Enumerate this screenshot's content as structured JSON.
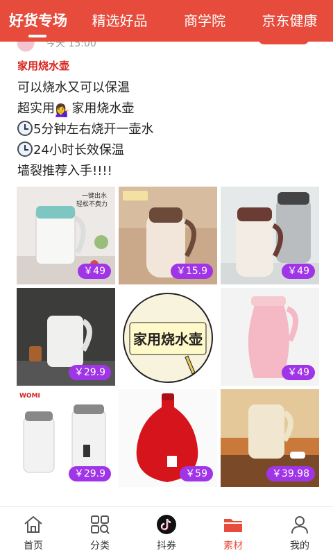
{
  "top_tabs": [
    {
      "label": "好货专场",
      "active": true
    },
    {
      "label": "精选好品",
      "active": false
    },
    {
      "label": "商学院",
      "active": false
    },
    {
      "label": "京东健康",
      "active": false
    }
  ],
  "post": {
    "time": "今天 15:00",
    "product_title": "家用烧水壶",
    "lines": [
      {
        "icon": "",
        "text": "可以烧水又可以保温"
      },
      {
        "icon": "",
        "text": "超实用",
        "emoji": "💁‍♀️",
        "text2": "家用烧水壶"
      },
      {
        "icon": "clock",
        "text": "5分钟左右烧开一壶水"
      },
      {
        "icon": "clock",
        "text": "24小时长效保温"
      },
      {
        "icon": "",
        "text": "墙裂推荐入手!!!!"
      }
    ],
    "images": [
      {
        "price": "￥49",
        "subject": "white-green-kettle",
        "overlay": "一键出水 轻松不费力"
      },
      {
        "price": "￥15.9",
        "subject": "cream-thermos-jug"
      },
      {
        "price": "￥49",
        "subject": "two-vacuum-jugs"
      },
      {
        "price": "￥29.9",
        "subject": "white-electric-kettle"
      },
      {
        "price": "",
        "subject": "text-card",
        "card_text": "家用烧水壶"
      },
      {
        "price": "￥49",
        "subject": "pink-thermos-jug"
      },
      {
        "price": "￥29.9",
        "subject": "two-white-kettles",
        "brand": "WOMI"
      },
      {
        "price": "￥59",
        "subject": "red-thermos-jug"
      },
      {
        "price": "￥39.98",
        "subject": "cream-kettle-desk"
      }
    ]
  },
  "bottom_nav": [
    {
      "label": "首页",
      "icon": "home-icon",
      "active": false
    },
    {
      "label": "分类",
      "icon": "category-icon",
      "active": false
    },
    {
      "label": "抖券",
      "icon": "douyin-icon",
      "active": false
    },
    {
      "label": "素材",
      "icon": "folder-icon",
      "active": true
    },
    {
      "label": "我的",
      "icon": "user-icon",
      "active": false
    }
  ],
  "colors": {
    "brand_red": "#e64b3c",
    "price_badge": "#a035e8",
    "title_red": "#d9251d"
  }
}
